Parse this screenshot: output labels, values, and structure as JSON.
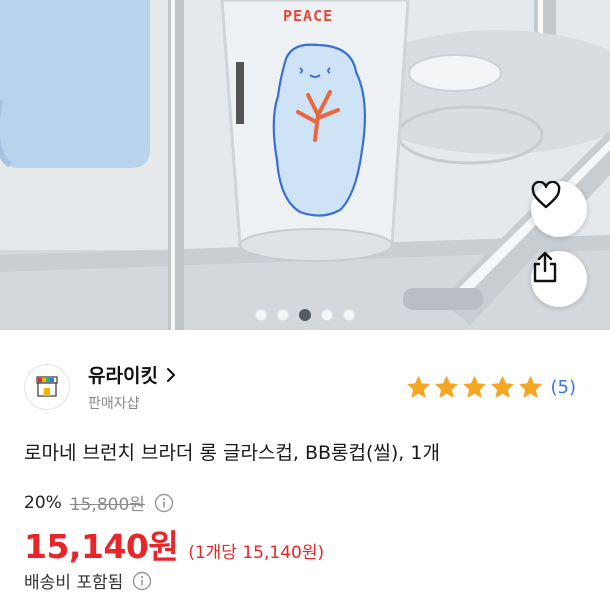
{
  "product_image": {
    "glass_print_text": "PEACE",
    "carousel": {
      "count": 5,
      "active_index": 2
    }
  },
  "actions": {
    "like_icon": "heart-icon",
    "share_icon": "share-icon"
  },
  "seller": {
    "name": "유라이킷",
    "subtitle": "판매자샵",
    "logo_icon": "shop-icon"
  },
  "rating": {
    "stars": 5,
    "count_label": "(5)",
    "star_color": "#f5a623"
  },
  "product": {
    "title": "로마네 브런치 브라더 롱 글라스컵, BB롱컵(씰), 1개",
    "discount_rate": "20%",
    "original_price": "15,800원",
    "price": "15,140원",
    "unit_price": "(1개당 15,140원)",
    "shipping": "배송비 포함됨"
  },
  "colors": {
    "price_red": "#e8262a",
    "link_blue": "#3a76e8"
  }
}
